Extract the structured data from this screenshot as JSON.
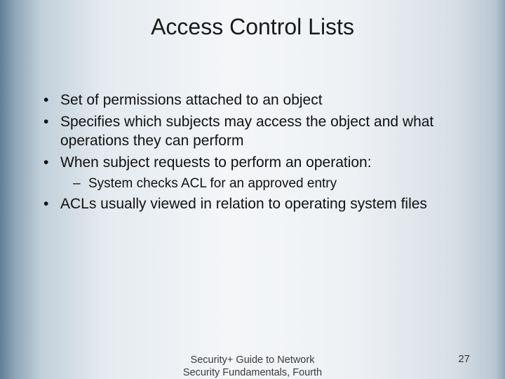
{
  "title": "Access Control Lists",
  "bullets": {
    "b1": "Set of permissions attached to an object",
    "b2": "Specifies which subjects may access the object and what operations they can perform",
    "b3": "When subject requests to perform an operation:",
    "b3_sub1": "System checks ACL for an approved entry",
    "b4": "ACLs usually viewed in relation to operating system files"
  },
  "footer": {
    "line1": "Security+ Guide to Network",
    "line2": "Security Fundamentals, Fourth"
  },
  "page_number": "27"
}
